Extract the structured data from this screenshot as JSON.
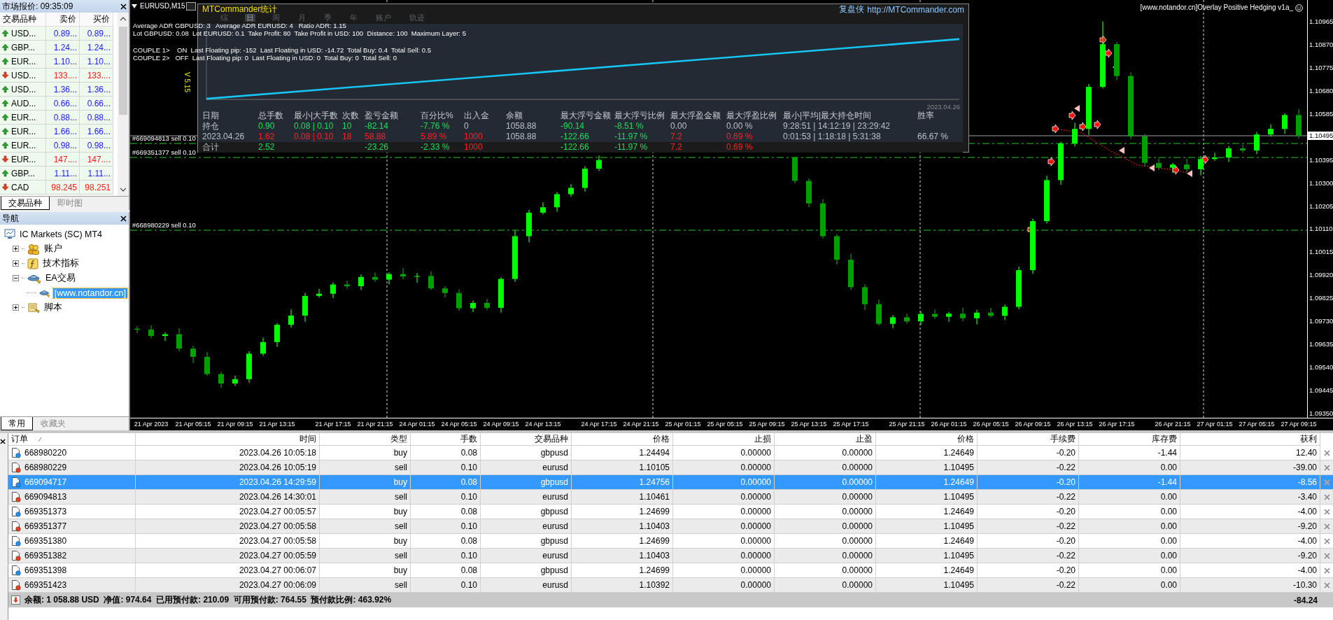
{
  "market_watch": {
    "title": "市场报价: 09:35:09",
    "columns": [
      "交易品种",
      "卖价",
      "买价"
    ],
    "rows": [
      {
        "symbol": "USD...",
        "bid": "0.89...",
        "ask": "0.89...",
        "up": true
      },
      {
        "symbol": "GBP...",
        "bid": "1.24...",
        "ask": "1.24...",
        "up": true
      },
      {
        "symbol": "EUR...",
        "bid": "1.10...",
        "ask": "1.10...",
        "up": true
      },
      {
        "symbol": "USD...",
        "bid": "133....",
        "ask": "133....",
        "up": false
      },
      {
        "symbol": "USD...",
        "bid": "1.36...",
        "ask": "1.36...",
        "up": true
      },
      {
        "symbol": "AUD...",
        "bid": "0.66...",
        "ask": "0.66...",
        "up": true
      },
      {
        "symbol": "EUR...",
        "bid": "0.88...",
        "ask": "0.88...",
        "up": true
      },
      {
        "symbol": "EUR...",
        "bid": "1.66...",
        "ask": "1.66...",
        "up": true
      },
      {
        "symbol": "EUR...",
        "bid": "0.98...",
        "ask": "0.98...",
        "up": true
      },
      {
        "symbol": "EUR...",
        "bid": "147....",
        "ask": "147....",
        "up": false
      },
      {
        "symbol": "GBP...",
        "bid": "1.11...",
        "ask": "1.11...",
        "up": true
      },
      {
        "symbol": "CAD",
        "bid": "98.245",
        "ask": "98.251",
        "up": false
      }
    ],
    "tabs": [
      {
        "label": "交易品种",
        "selected": true
      },
      {
        "label": "即时图",
        "selected": false
      }
    ]
  },
  "navigator": {
    "title": "导航",
    "tree": [
      {
        "label": "IC Markets (SC) MT4",
        "kind": "terminal",
        "selected": false,
        "children": [
          {
            "label": "账户",
            "kind": "accounts",
            "expanded": false,
            "selected": false
          },
          {
            "label": "技术指标",
            "kind": "indicators",
            "expanded": false,
            "selected": false
          },
          {
            "label": "EA交易",
            "kind": "experts",
            "expanded": true,
            "selected": false,
            "children": [
              {
                "label": "[www.notandor.cn]",
                "kind": "expert",
                "selected": true
              }
            ]
          },
          {
            "label": "脚本",
            "kind": "scripts",
            "expanded": false,
            "selected": false
          }
        ]
      }
    ],
    "tabs": [
      {
        "label": "常用",
        "selected": true
      },
      {
        "label": "收藏夹",
        "selected": false
      }
    ]
  },
  "chart": {
    "title": "EURUSD,M15",
    "version": "V 5.15",
    "indicator_label": "[www.notandor.cn]Overlay Positive Hedging v1a_",
    "info_blocks": [
      [
        "Average ADR GBPUSD: 3   Average ADR EURUSD: 4   Ratio ADR: 1.15",
        "Lot GBPUSD: 0.08  Lot EURUSD: 0.1  Take Profit: 80  Take Profit in USD: 100  Distance: 100  Maximum Layer: 5"
      ],
      [
        "COUPLE 1>    ON  Last Floating pip: -152  Last Floating in USD: -14.72  Total Buy: 0.4  Total Sell: 0.5",
        "COUPLE 2>   OFF  Last Floating pip: 0  Last Floating in USD: 0  Total Buy: 0  Total Sell: 0"
      ]
    ],
    "order_lines": [
      {
        "label": "#669094813 sell 0.10"
      },
      {
        "label": "#669351377 sell 0.10"
      },
      {
        "label": "#668980229 sell 0.10"
      }
    ],
    "current_price": "1.10495",
    "chart_data": {
      "type": "candlestick",
      "ylim": [
        1.09333,
        1.11054
      ],
      "yticks": [
        {
          "value": 1.10965,
          "label": "1.10965"
        },
        {
          "value": 1.1087,
          "label": "1.10870"
        },
        {
          "value": 1.10775,
          "label": "1.10775"
        },
        {
          "value": 1.1068,
          "label": "1.10680"
        },
        {
          "value": 1.10585,
          "label": "1.10585"
        },
        {
          "value": 1.10395,
          "label": "1.10395"
        },
        {
          "value": 1.103,
          "label": "1.10300"
        },
        {
          "value": 1.10205,
          "label": "1.10205"
        },
        {
          "value": 1.1011,
          "label": "1.10110"
        },
        {
          "value": 1.10015,
          "label": "1.10015"
        },
        {
          "value": 1.0992,
          "label": "1.09920"
        },
        {
          "value": 1.09825,
          "label": "1.09825"
        },
        {
          "value": 1.0973,
          "label": "1.09730"
        },
        {
          "value": 1.09635,
          "label": "1.09635"
        },
        {
          "value": 1.0954,
          "label": "1.09540"
        },
        {
          "value": 1.09445,
          "label": "1.09445"
        },
        {
          "value": 1.0935,
          "label": "1.09350"
        }
      ],
      "categories": [
        null,
        "21 Apr 2023",
        null,
        null,
        "21 Apr 05:15",
        null,
        null,
        "21 Apr 09:15",
        null,
        null,
        "21 Apr 13:15",
        null,
        null,
        null,
        "21 Apr 17:15",
        null,
        null,
        "21 Apr 21:15",
        null,
        null,
        "24 Apr 01:15",
        null,
        null,
        "24 Apr 05:15",
        null,
        null,
        "24 Apr 09:15",
        null,
        null,
        "24 Apr 13:15",
        null,
        null,
        null,
        "24 Apr 17:15",
        null,
        null,
        "24 Apr 21:15",
        null,
        null,
        "25 Apr 01:15",
        null,
        null,
        "25 Apr 05:15",
        null,
        null,
        "25 Apr 09:15",
        null,
        null,
        "25 Apr 13:15",
        null,
        null,
        "25 Apr 17:15",
        null,
        null,
        null,
        "25 Apr 21:15",
        null,
        null,
        "26 Apr 01:15",
        null,
        null,
        "26 Apr 05:15",
        null,
        null,
        "26 Apr 09:15",
        null,
        null,
        "26 Apr 13:15",
        null,
        null,
        "26 Apr 17:15",
        null,
        null,
        null,
        "26 Apr 21:15",
        null,
        null,
        "27 Apr 01:15",
        null,
        null,
        "27 Apr 05:15",
        null,
        null,
        "27 Apr 09:15"
      ],
      "ohlc": [
        [
          1.097,
          1.0971,
          1.09681,
          1.09696
        ],
        [
          1.09696,
          1.09714,
          1.09661,
          1.0967
        ],
        [
          1.0967,
          1.09684,
          1.0965,
          1.09677
        ],
        [
          1.09677,
          1.09702,
          1.09606,
          1.09618
        ],
        [
          1.09618,
          1.0963,
          1.09559,
          1.09584
        ],
        [
          1.09584,
          1.09604,
          1.09506,
          1.09513
        ],
        [
          1.09513,
          1.09522,
          1.09456,
          1.09474
        ],
        [
          1.09474,
          1.09507,
          1.09464,
          1.09492
        ],
        [
          1.09492,
          1.09607,
          1.09477,
          1.09597
        ],
        [
          1.09597,
          1.09663,
          1.09588,
          1.09645
        ],
        [
          1.09645,
          1.09723,
          1.09625,
          1.09716
        ],
        [
          1.09716,
          1.09779,
          1.09704,
          1.09754
        ],
        [
          1.09754,
          1.09847,
          1.09729,
          1.09835
        ],
        [
          1.09835,
          1.09864,
          1.09828,
          1.09844
        ],
        [
          1.09844,
          1.09891,
          1.09826,
          1.09882
        ],
        [
          1.09882,
          1.09897,
          1.09865,
          1.09875
        ],
        [
          1.09875,
          1.09923,
          1.0986,
          1.09913
        ],
        [
          1.09913,
          1.09931,
          1.09893,
          1.09902
        ],
        [
          1.09902,
          1.09932,
          1.09882,
          1.09925
        ],
        [
          1.09925,
          1.0995,
          1.09903,
          1.09915
        ],
        [
          1.09915,
          1.09929,
          1.0989,
          1.09917
        ],
        [
          1.09917,
          1.09937,
          1.09859,
          1.09866
        ],
        [
          1.09866,
          1.09875,
          1.09829,
          1.09847
        ],
        [
          1.09847,
          1.09862,
          1.09774,
          1.09784
        ],
        [
          1.09784,
          1.09816,
          1.09769,
          1.09806
        ],
        [
          1.09806,
          1.09824,
          1.09777,
          1.09786
        ],
        [
          1.09786,
          1.09912,
          1.09766,
          1.09905
        ],
        [
          1.09905,
          1.10106,
          1.09893,
          1.10081
        ],
        [
          1.10081,
          1.1019,
          1.10056,
          1.10178
        ],
        [
          1.10178,
          1.1022,
          1.10171,
          1.102
        ],
        [
          1.102,
          1.10263,
          1.10182,
          1.10254
        ],
        [
          1.10254,
          1.10295,
          1.10244,
          1.1028
        ],
        [
          1.1028,
          1.10369,
          1.10265,
          1.10359
        ],
        [
          1.10359,
          1.10413,
          1.1035,
          1.10395
        ],
        null,
        null,
        null,
        null,
        null,
        null,
        null,
        null,
        null,
        null,
        null,
        null,
        null,
        [
          1.10405,
          1.10408,
          1.10299,
          1.10309
        ],
        [
          1.10309,
          1.10319,
          1.10201,
          1.10216
        ],
        [
          1.10216,
          1.10234,
          1.10072,
          1.10081
        ],
        [
          1.10081,
          1.10088,
          1.09964,
          1.09984
        ],
        [
          1.09984,
          1.10009,
          1.09859,
          1.09871
        ],
        [
          1.09871,
          1.09883,
          1.09776,
          1.09801
        ],
        [
          1.09801,
          1.09821,
          1.09713,
          1.0972
        ],
        [
          1.0972,
          1.09756,
          1.09702,
          1.09747
        ],
        [
          1.09747,
          1.09762,
          1.0972,
          1.0973
        ],
        [
          1.0973,
          1.09771,
          1.09715,
          1.09761
        ],
        [
          1.09761,
          1.09779,
          1.0974,
          1.09749
        ],
        [
          1.09749,
          1.09769,
          1.09729,
          1.09762
        ],
        [
          1.09762,
          1.09787,
          1.09731,
          1.09743
        ],
        [
          1.09743,
          1.09778,
          1.09718,
          1.09766
        ],
        [
          1.09766,
          1.09786,
          1.09746,
          1.09753
        ],
        [
          1.09753,
          1.09799,
          1.09735,
          1.0979
        ],
        [
          1.0979,
          1.09956,
          1.0978,
          1.09941
        ],
        [
          1.09941,
          1.10153,
          1.09926,
          1.10143
        ],
        [
          1.10143,
          1.1033,
          1.10134,
          1.10312
        ],
        [
          1.10312,
          1.1047,
          1.10292,
          1.10463
        ],
        [
          1.10463,
          1.10548,
          1.10451,
          1.10523
        ],
        [
          1.10523,
          1.10708,
          1.10498,
          1.10696
        ],
        [
          1.10696,
          1.10965,
          1.10689,
          1.10872
        ],
        [
          1.10872,
          1.10881,
          1.10723,
          1.10741
        ],
        [
          1.10741,
          1.10756,
          1.10482,
          1.10492
        ],
        [
          1.10492,
          1.10502,
          1.10368,
          1.10383
        ],
        [
          1.10383,
          1.10401,
          1.10354,
          1.10363
        ],
        [
          1.10363,
          1.10383,
          1.10343,
          1.10376
        ],
        [
          1.10376,
          1.10401,
          1.10345,
          1.10357
        ],
        [
          1.10357,
          1.10411,
          1.10332,
          1.10399
        ],
        [
          1.10399,
          1.10425,
          1.10392,
          1.10405
        ],
        [
          1.10405,
          1.10452,
          1.10387,
          1.10443
        ],
        [
          1.10443,
          1.10458,
          1.10424,
          1.10434
        ],
        [
          1.10434,
          1.1051,
          1.10419,
          1.105
        ],
        [
          1.105,
          1.10541,
          1.10491,
          1.10523
        ],
        [
          1.10523,
          1.10587,
          1.10503,
          1.1058
        ],
        [
          1.1058,
          1.10605,
          1.10483,
          1.10495
        ]
      ]
    }
  },
  "stats_panel": {
    "title": "MTCommander统计",
    "tabs": [
      {
        "label": "综",
        "selected": false
      },
      {
        "label": "日",
        "selected": true
      },
      {
        "label": "周",
        "selected": false
      },
      {
        "label": "月",
        "selected": false
      },
      {
        "label": "季",
        "selected": false
      },
      {
        "label": "年",
        "selected": false
      },
      {
        "label": "账户",
        "selected": false
      },
      {
        "label": "轨迹",
        "selected": false
      }
    ],
    "brand": "复盘侠",
    "link": "http://MTCommander.com",
    "chart_date": "2023.04.26",
    "columns": [
      "日期",
      "总手数",
      "最小|大手数",
      "次数",
      "盈亏金额",
      "百分比%",
      "出入金",
      "余额",
      "最大浮亏金额",
      "最大浮亏比例",
      "最大浮盈金额",
      "最大浮盈比例",
      "最小|平均|最大持仓时间",
      "胜率"
    ],
    "rows": [
      {
        "kind": "normal",
        "cells": [
          {
            "text": "持仓"
          },
          {
            "text": "0.90",
            "color": "#19e05a"
          },
          {
            "text": "0.08 | 0.10",
            "color": "#19e05a"
          },
          {
            "text": "10",
            "color": "#19e05a"
          },
          {
            "text": "-82.14",
            "color": "#19e05a"
          },
          {
            "text": "-7.76 %",
            "color": "#19e05a"
          },
          {
            "text": "0",
            "color": "#b8c0c8"
          },
          {
            "text": "1058.88",
            "color": "#b8c0c8"
          },
          {
            "text": "-90.14",
            "color": "#19e05a"
          },
          {
            "text": "-8.51 %",
            "color": "#19e05a"
          },
          {
            "text": "0.00",
            "color": "#b8c0c8"
          },
          {
            "text": "0.00 %",
            "color": "#b8c0c8"
          },
          {
            "text": "9:28:51 | 14:12:19 | 23:29:42",
            "color": "#b8c0c8"
          },
          null
        ]
      },
      {
        "kind": "normal",
        "cells": [
          {
            "text": "2023.04.26"
          },
          {
            "text": "1.62",
            "color": "#ff2020"
          },
          {
            "text": "0.08 | 0.10",
            "color": "#ff2020"
          },
          {
            "text": "18",
            "color": "#ff2020"
          },
          {
            "text": "58.88",
            "color": "#ff2020"
          },
          {
            "text": "5.89 %",
            "color": "#ff2020"
          },
          {
            "text": "1000",
            "color": "#ff2020"
          },
          {
            "text": "1058.88",
            "color": "#b8c0c8"
          },
          {
            "text": "-122.66",
            "color": "#19e05a"
          },
          {
            "text": "-11.97 %",
            "color": "#19e05a"
          },
          {
            "text": "7.2",
            "color": "#ff2020"
          },
          {
            "text": "0.69 %",
            "color": "#ff2020"
          },
          {
            "text": "0:01:53 | 1:18:18 | 5:31:38",
            "color": "#b8c0c8"
          },
          {
            "text": "66.67 %",
            "color": "#b8c0c8"
          }
        ]
      },
      {
        "kind": "total",
        "cells": [
          {
            "text": "合计"
          },
          {
            "text": "2.52",
            "color": "#19e05a"
          },
          null,
          null,
          {
            "text": "-23.26",
            "color": "#19e05a"
          },
          {
            "text": "-2.33 %",
            "color": "#19e05a"
          },
          {
            "text": "1000",
            "color": "#ff2020"
          },
          null,
          {
            "text": "-122.66",
            "color": "#19e05a"
          },
          {
            "text": "-11.97 %",
            "color": "#19e05a"
          },
          {
            "text": "7.2",
            "color": "#ff2020"
          },
          {
            "text": "0.69 %",
            "color": "#ff2020"
          },
          null,
          null
        ]
      }
    ]
  },
  "terminal": {
    "columns": [
      "订单",
      "时间",
      "类型",
      "手数",
      "交易品种",
      "价格",
      "止损",
      "止盈",
      "价格",
      "手续费",
      "库存费",
      "获利"
    ],
    "rows": [
      {
        "kind": "buy",
        "selected": false,
        "cells": [
          "668980220",
          "2023.04.26 10:05:18",
          "buy",
          "0.08",
          "gbpusd",
          "1.24494",
          "0.00000",
          "0.00000",
          "1.24649",
          "-0.20",
          "-1.44",
          "12.40"
        ]
      },
      {
        "kind": "sell",
        "selected": false,
        "cells": [
          "668980229",
          "2023.04.26 10:05:19",
          "sell",
          "0.10",
          "eurusd",
          "1.10105",
          "0.00000",
          "0.00000",
          "1.10495",
          "-0.22",
          "0.00",
          "-39.00"
        ]
      },
      {
        "kind": "buy",
        "selected": true,
        "cells": [
          "669094717",
          "2023.04.26 14:29:59",
          "buy",
          "0.08",
          "gbpusd",
          "1.24756",
          "0.00000",
          "0.00000",
          "1.24649",
          "-0.20",
          "-1.44",
          "-8.56"
        ]
      },
      {
        "kind": "sell",
        "selected": false,
        "cells": [
          "669094813",
          "2023.04.26 14:30:01",
          "sell",
          "0.10",
          "eurusd",
          "1.10461",
          "0.00000",
          "0.00000",
          "1.10495",
          "-0.22",
          "0.00",
          "-3.40"
        ]
      },
      {
        "kind": "buy",
        "selected": false,
        "cells": [
          "669351373",
          "2023.04.27 00:05:57",
          "buy",
          "0.08",
          "gbpusd",
          "1.24699",
          "0.00000",
          "0.00000",
          "1.24649",
          "-0.20",
          "0.00",
          "-4.00"
        ]
      },
      {
        "kind": "sell",
        "selected": false,
        "cells": [
          "669351377",
          "2023.04.27 00:05:58",
          "sell",
          "0.10",
          "eurusd",
          "1.10403",
          "0.00000",
          "0.00000",
          "1.10495",
          "-0.22",
          "0.00",
          "-9.20"
        ]
      },
      {
        "kind": "buy",
        "selected": false,
        "cells": [
          "669351380",
          "2023.04.27 00:05:58",
          "buy",
          "0.08",
          "gbpusd",
          "1.24699",
          "0.00000",
          "0.00000",
          "1.24649",
          "-0.20",
          "0.00",
          "-4.00"
        ]
      },
      {
        "kind": "sell",
        "selected": false,
        "cells": [
          "669351382",
          "2023.04.27 00:05:59",
          "sell",
          "0.10",
          "eurusd",
          "1.10403",
          "0.00000",
          "0.00000",
          "1.10495",
          "-0.22",
          "0.00",
          "-9.20"
        ]
      },
      {
        "kind": "buy",
        "selected": false,
        "cells": [
          "669351398",
          "2023.04.27 00:06:07",
          "buy",
          "0.08",
          "gbpusd",
          "1.24699",
          "0.00000",
          "0.00000",
          "1.24649",
          "-0.20",
          "0.00",
          "-4.00"
        ]
      },
      {
        "kind": "sell",
        "selected": false,
        "cells": [
          "669351423",
          "2023.04.27 00:06:09",
          "sell",
          "0.10",
          "eurusd",
          "1.10392",
          "0.00000",
          "0.00000",
          "1.10495",
          "-0.22",
          "0.00",
          "-10.30"
        ]
      }
    ],
    "summary": {
      "text": "余额: 1 058.88 USD  净值: 974.64  已用预付款: 210.09  可用预付款: 764.55  预付款比例: 463.92%",
      "profit": "-84.24"
    }
  }
}
